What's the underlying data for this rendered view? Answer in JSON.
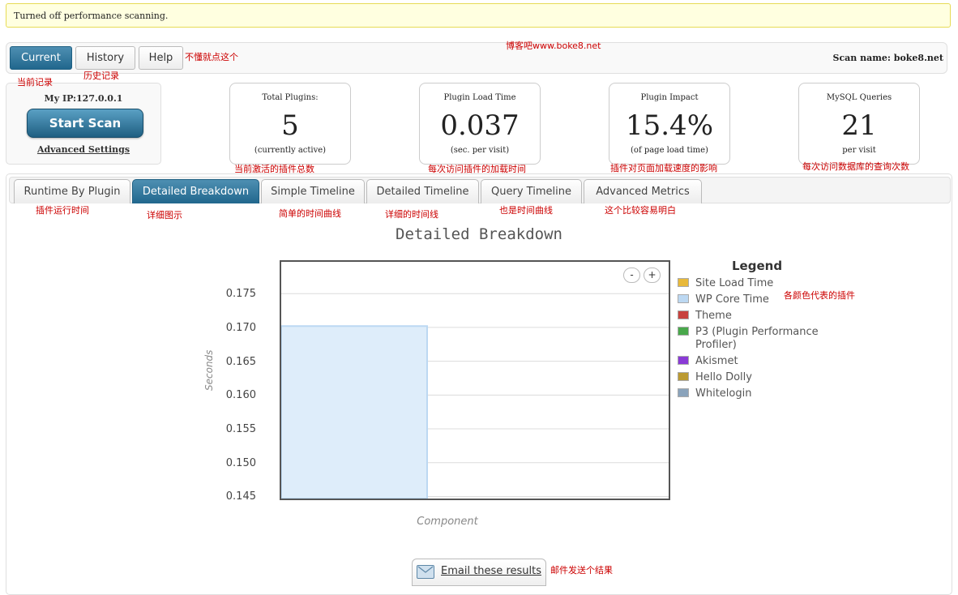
{
  "notice": "Turned off performance scanning.",
  "nav": {
    "current": "Current",
    "history": "History",
    "help": "Help"
  },
  "scan_name": "Scan name: boke8.net",
  "ip": "My IP:127.0.0.1",
  "start_scan": "Start Scan",
  "advanced_settings": "Advanced Settings",
  "stats": [
    {
      "label": "Total Plugins:",
      "value": "5",
      "sub": "(currently active)"
    },
    {
      "label": "Plugin Load Time",
      "value": "0.037",
      "sub": "(sec. per visit)"
    },
    {
      "label": "Plugin Impact",
      "value": "15.4%",
      "sub": "(of page load time)"
    },
    {
      "label": "MySQL Queries",
      "value": "21",
      "sub": "per visit"
    }
  ],
  "tabs": [
    "Runtime By Plugin",
    "Detailed Breakdown",
    "Simple Timeline",
    "Detailed Timeline",
    "Query Timeline",
    "Advanced Metrics"
  ],
  "chart_title": "Detailed Breakdown",
  "zoom": {
    "out": "-",
    "in": "+"
  },
  "chart_data": {
    "type": "bar",
    "title": "Detailed Breakdown",
    "xlabel": "Component",
    "ylabel": "Seconds",
    "ylim": [
      0.1435,
      0.1785
    ],
    "yticks": [
      "0.175",
      "0.170",
      "0.165",
      "0.160",
      "0.155",
      "0.150",
      "0.145"
    ],
    "grid": true,
    "legend_position": "right",
    "series": [
      {
        "name": "WP Core Time",
        "color": "#bcd8f2",
        "values": [
          0.169
        ]
      }
    ]
  },
  "legend": {
    "title": "Legend",
    "items": [
      {
        "label": "Site Load Time",
        "color": "#e8b93a"
      },
      {
        "label": "WP Core Time",
        "color": "#bcd8f2"
      },
      {
        "label": "Theme",
        "color": "#c8423e"
      },
      {
        "label": "P3 (Plugin Performance Profiler)",
        "color": "#49a84b"
      },
      {
        "label": "Akismet",
        "color": "#8a3ad6"
      },
      {
        "label": "Hello Dolly",
        "color": "#bb9a32"
      },
      {
        "label": "Whitelogin",
        "color": "#8aa3bb"
      }
    ]
  },
  "email_results": "Email these results",
  "annotations": {
    "help_note": "不懂就点这个",
    "site": "博客吧www.boke8.net",
    "current_record": "当前记录",
    "history_record": "历史记录",
    "total_plugins": "当前激活的插件总数",
    "load_time": "每次访问插件的加载时间",
    "impact": "插件对页面加载速度的影响",
    "queries": "每次访问数据库的查询次数",
    "runtime": "插件运行时间",
    "breakdown": "详细图示",
    "simple_timeline": "简单的时间曲线",
    "detailed_timeline": "详细的时间线",
    "query_timeline": "也是时间曲线",
    "advanced": "这个比较容易明白",
    "legend_note": "各颜色代表的插件",
    "email_note": "邮件发送个结果"
  }
}
